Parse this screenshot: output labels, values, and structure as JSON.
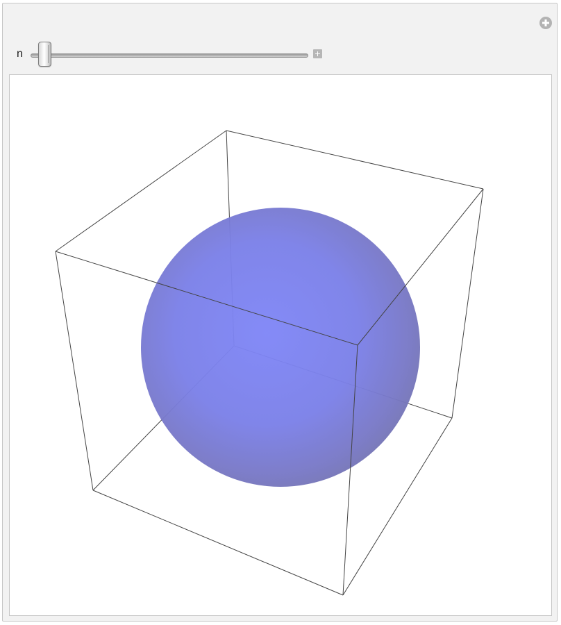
{
  "controls": {
    "variable_label": "n",
    "slider_value_fraction": 0.03,
    "slider_value": null
  },
  "icons": {
    "options": "plus-circle-icon",
    "expand": "plus-square-icon"
  },
  "plot": {
    "type": "3d-sphere-in-box",
    "box_color": "#444444",
    "sphere_color": "#7b80e8",
    "sphere_edge_color": "#7779c0"
  }
}
